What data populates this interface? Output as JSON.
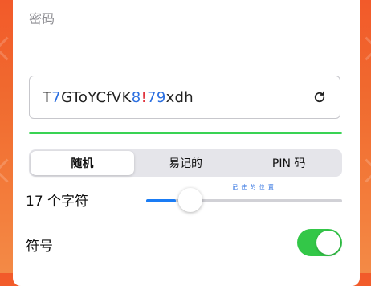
{
  "password_section": {
    "label": "密码",
    "password_parts": [
      {
        "t": "T",
        "k": "n"
      },
      {
        "t": "7",
        "k": "d"
      },
      {
        "t": "GToYCfVK",
        "k": "n"
      },
      {
        "t": "8",
        "k": "d"
      },
      {
        "t": "!",
        "k": "s"
      },
      {
        "t": "79",
        "k": "d"
      },
      {
        "t": "xdh",
        "k": "n"
      }
    ],
    "password_value": "T7GToYCfVK8!79xdh",
    "refresh_icon": "refresh-icon",
    "strength_color": "#39d353"
  },
  "modes": {
    "options": [
      "随机",
      "易记的",
      "PIN 码"
    ],
    "selected": "随机"
  },
  "length": {
    "label": "17 个字符",
    "value": 17,
    "level": 0.15
  },
  "tiny_text": "记 住 的 位 置",
  "symbols": {
    "label": "符号",
    "enabled": true,
    "on_color": "#33c748"
  },
  "colors": {
    "background": "#f25a2a",
    "digit": "#2b6fe0",
    "symbol": "#e0323c",
    "accent": "#1a7cf5"
  }
}
